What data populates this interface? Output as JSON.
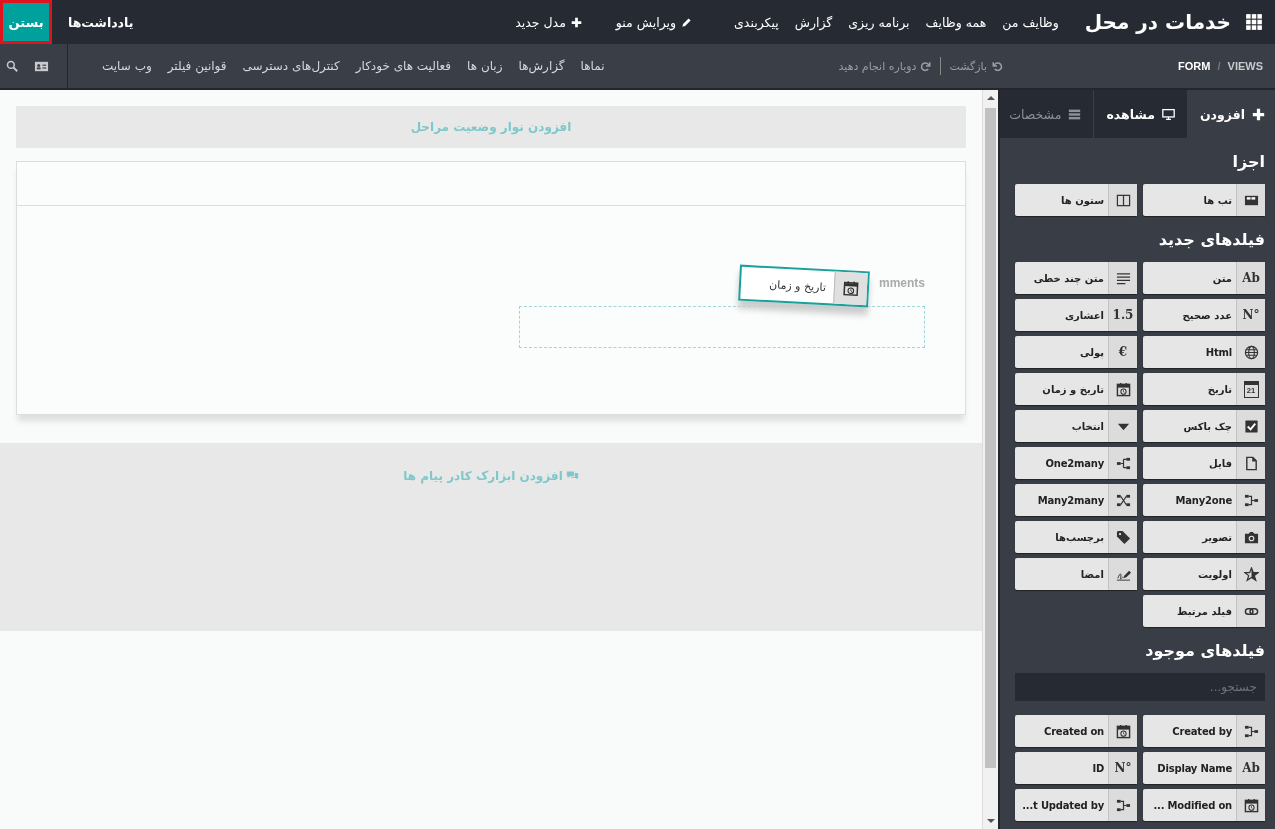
{
  "app": {
    "title": "خدمات در محل",
    "menu": [
      "وظایف من",
      "همه وظایف",
      "برنامه ریزی",
      "گزارش",
      "پیکربندی"
    ],
    "edit_menu": "ویرایش منو",
    "new_model": "مدل جدید",
    "notes": "یادداشت‌ها",
    "close": {
      "label": "بستن",
      "highlighted": true
    }
  },
  "toolbar": {
    "breadcrumb": [
      "VIEWS",
      "FORM"
    ],
    "breadcrumb_separator": "/",
    "undo": "بازگشت",
    "redo": "دوباره انجام دهید",
    "tabs": [
      "نماها",
      "گزارش‌ها",
      "زبان ها",
      "فعالیت های خودکار",
      "کنترل‌های دسترسی",
      "قوانین فیلتر",
      "وب سایت"
    ]
  },
  "editor": {
    "statusbar_hint": "افزودن نوار وضعیت مراحل",
    "field_label": "mments",
    "dragged_field": "تاریخ و زمان",
    "chatter_hint": "افزودن ابزارک کادر پیام ها"
  },
  "sidebar": {
    "tabs": [
      {
        "label": "افزودن",
        "selected": true,
        "disabled": false
      },
      {
        "label": "مشاهده",
        "selected": false,
        "disabled": false
      },
      {
        "label": "مشخصات",
        "selected": false,
        "disabled": true
      }
    ],
    "sections": [
      {
        "title": "اجزا",
        "items": [
          {
            "label": "تب ها"
          },
          {
            "label": "ستون ها"
          }
        ]
      },
      {
        "title": "فیلدهای جدید",
        "items": [
          {
            "label": "متن",
            "icon_text": "Ab"
          },
          {
            "label": "متن چند خطی"
          },
          {
            "label": "عدد صحیح",
            "icon_text": "N°"
          },
          {
            "label": "اعشاری",
            "icon_text": "1.5"
          },
          {
            "label": "Html"
          },
          {
            "label": "پولی",
            "icon_text": "€"
          },
          {
            "label": "تاریخ",
            "icon_text": "21"
          },
          {
            "label": "تاریخ و زمان"
          },
          {
            "label": "چک باکس"
          },
          {
            "label": "انتخاب"
          },
          {
            "label": "فایل"
          },
          {
            "label": "One2many"
          },
          {
            "label": "Many2one"
          },
          {
            "label": "Many2many"
          },
          {
            "label": "تصویر"
          },
          {
            "label": "برچسب‌ها"
          },
          {
            "label": "اولویت"
          },
          {
            "label": "امضا"
          },
          {
            "label": "فیلد مرتبط"
          }
        ]
      },
      {
        "title": "فیلدهای موجود",
        "search": {
          "placeholder": "جستجو..."
        },
        "items": [
          {
            "label": "Created by"
          },
          {
            "label": "Created on"
          },
          {
            "label": "Display Name",
            "icon_text": "Ab"
          },
          {
            "label": "ID",
            "icon_text": "N°"
          },
          {
            "label": "... Modified on"
          },
          {
            "label": "...t Updated by"
          }
        ]
      }
    ]
  }
}
